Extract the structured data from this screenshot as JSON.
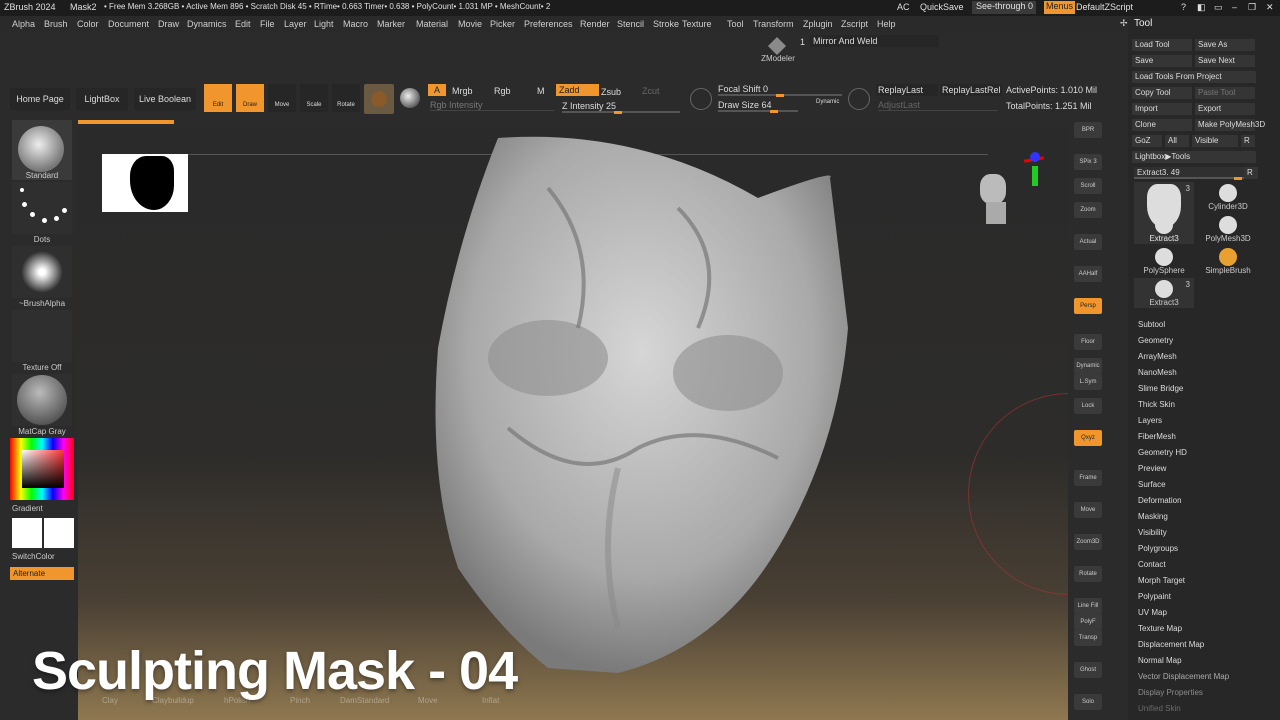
{
  "titlebar": {
    "app": "ZBrush 2024",
    "doc": "Mask2",
    "stats": "• Free Mem 3.268GB • Active Mem 896 • Scratch Disk 45 • RTime• 0.663 Timer• 0.638 • PolyCount• 1.031 MP • MeshCount• 2",
    "ac": "AC",
    "quicksave": "QuickSave",
    "seethrough": "See-through 0",
    "menus": "Menus",
    "script": "DefaultZScript"
  },
  "menubar": [
    "Alpha",
    "Brush",
    "Color",
    "Document",
    "Draw",
    "Dynamics",
    "Edit",
    "File",
    "Layer",
    "Light",
    "Macro",
    "Marker",
    "Material",
    "Movie",
    "Picker",
    "Preferences",
    "Render",
    "Stencil",
    "Stroke",
    "Texture",
    "Tool",
    "Transform",
    "Zplugin",
    "Zscript",
    "Help"
  ],
  "zmodeler": {
    "label": "ZModeler",
    "count": "1",
    "action": "Mirror And Weld"
  },
  "shelf": {
    "home": "Home Page",
    "lightbox": "LightBox",
    "liveboolean": "Live Boolean",
    "edit": "Edit",
    "draw": "Draw",
    "move": "Move",
    "scale": "Scale",
    "rotate": "Rotate",
    "a": "A",
    "mrgb": "Mrgb",
    "rgb": "Rgb",
    "m": "M",
    "zadd": "Zadd",
    "zsub": "Zsub",
    "zcut": "Zcut",
    "rgb_intensity": "Rgb Intensity",
    "z_intensity": "Z Intensity 25",
    "focal_shift": "Focal Shift 0",
    "draw_size": "Draw Size 64",
    "dynamic": "Dynamic",
    "replaylast": "ReplayLast",
    "replaylastrel": "ReplayLastRel",
    "adjustlast": "AdjustLast",
    "active_points": "ActivePoints: 1.010 Mil",
    "total_points": "TotalPoints: 1.251 Mil"
  },
  "left": {
    "brush": "Standard",
    "stroke": "Dots",
    "alpha": "~BrushAlpha",
    "texture": "Texture Off",
    "material": "MatCap Gray",
    "gradient": "Gradient",
    "switchcolor": "SwitchColor",
    "alternate": "Alternate"
  },
  "right_shelf": [
    "BPR",
    "SPix 3",
    "Scroll",
    "Zoom",
    "Actual",
    "AAHalf",
    "Persp",
    "Floor",
    "Dynamic",
    "L.Sym",
    "Lock",
    "Qxyz",
    "Frame",
    "Move",
    "Zoom3D",
    "Rotate",
    "Line Fill",
    "PolyF",
    "Transp",
    "Ghost",
    "Solo"
  ],
  "tool": {
    "title": "Tool",
    "buttons": [
      [
        "Load Tool",
        "Save As"
      ],
      [
        "Save",
        "Save Next"
      ],
      [
        "Load Tools From Project"
      ],
      [
        "Copy Tool",
        "Paste Tool"
      ],
      [
        "Import",
        "Export"
      ],
      [
        "Clone",
        "Make PolyMesh3D"
      ],
      [
        "GoZ",
        "All",
        "Visible",
        "R"
      ],
      [
        "Lightbox▶Tools"
      ]
    ],
    "current": "Extract3. 49",
    "current_r": "R",
    "thumbs": [
      {
        "name": "Extract3",
        "count": "3"
      },
      {
        "name": "Cylinder3D",
        "count": ""
      },
      {
        "name": "Extract3",
        "count": ""
      },
      {
        "name": "PolyMesh3D",
        "count": ""
      },
      {
        "name": "PolySphere",
        "count": ""
      },
      {
        "name": "SimpleBrush",
        "count": ""
      },
      {
        "name": "Extract3",
        "count": "3"
      }
    ],
    "subpalettes": [
      "Subtool",
      "Geometry",
      "ArrayMesh",
      "NanoMesh",
      "Slime Bridge",
      "Thick Skin",
      "Layers",
      "FiberMesh",
      "Geometry HD",
      "Preview",
      "Surface",
      "Deformation",
      "Masking",
      "Visibility",
      "Polygroups",
      "Contact",
      "Morph Target",
      "Polypaint",
      "UV Map",
      "Texture Map",
      "Displacement Map",
      "Normal Map",
      "Vector Displacement Map",
      "Display Properties",
      "Unified Skin"
    ]
  },
  "bottom_brushes": [
    "Clay",
    "Claybuildup",
    "hPolish",
    "Pinch",
    "DamStandard",
    "Move",
    "Inflat"
  ],
  "overlay_title": "Sculpting Mask - 04",
  "colors": {
    "accent": "#f0962c",
    "panel": "#2b2b2b",
    "menus": "#f0962c"
  }
}
